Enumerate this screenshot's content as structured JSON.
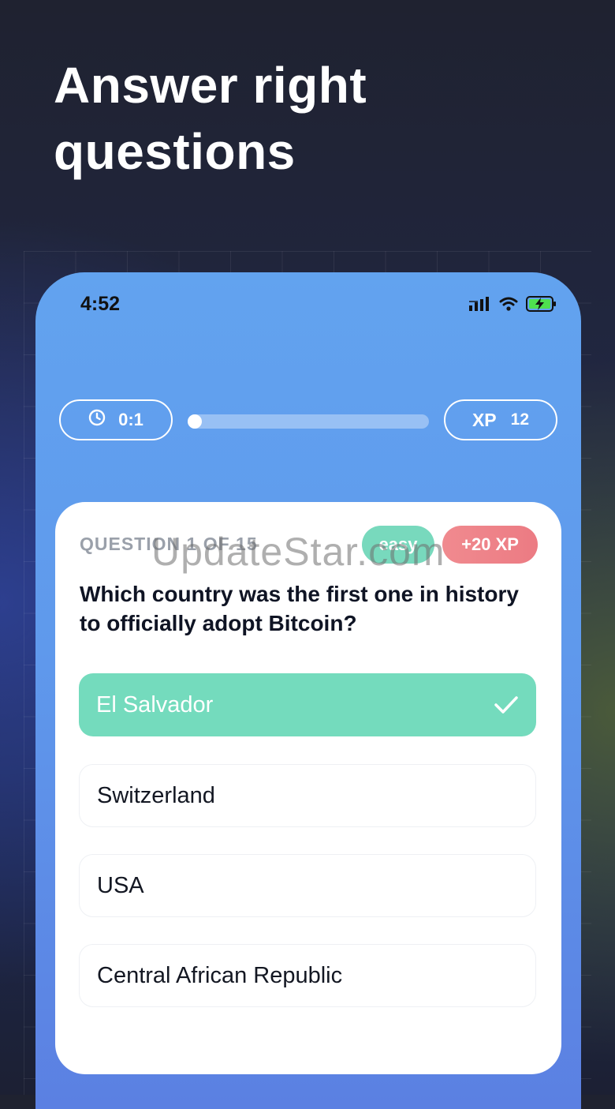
{
  "headline": {
    "line1": "Answer right",
    "line2": "questions"
  },
  "status_bar": {
    "time": "4:52"
  },
  "top_bar": {
    "timer": "0:1",
    "progress_fraction": 0.06,
    "xp_label": "XP",
    "xp_value": "12"
  },
  "question_card": {
    "counter": "QUESTION 1 OF 15",
    "difficulty": "easy",
    "reward": "+20 XP",
    "question": "Which country was the first one in history to officially adopt Bitcoin?",
    "options": [
      {
        "label": "El Salvador",
        "state": "correct"
      },
      {
        "label": "Switzerland",
        "state": "default"
      },
      {
        "label": "USA",
        "state": "default"
      },
      {
        "label": "Central African Republic",
        "state": "default"
      }
    ]
  },
  "watermark": "UpdateStar.com",
  "colors": {
    "phone_gradient_top": "#62a3ef",
    "correct_answer": "#74dbbd",
    "difficulty_badge": "#78d9bd",
    "reward_badge": "#ec7b83"
  },
  "icons": [
    "clock-icon",
    "signal-icon",
    "wifi-icon",
    "battery-charging-icon",
    "checkmark-icon"
  ]
}
